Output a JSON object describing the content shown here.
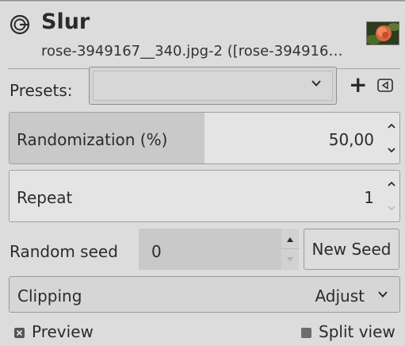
{
  "header": {
    "title": "Slur",
    "subtitle": "rose-3949167__340.jpg-2 ([rose-394916…"
  },
  "presets": {
    "label": "Presets:",
    "value": "",
    "add_label": "+"
  },
  "randomization": {
    "label": "Randomization (%)",
    "value": "50,00",
    "fraction": 0.5
  },
  "repeat": {
    "label": "Repeat",
    "value": "1"
  },
  "seed": {
    "label": "Random seed",
    "value": "0",
    "button_label": "New Seed"
  },
  "clipping": {
    "label": "Clipping",
    "value": "Adjust"
  },
  "preview": {
    "label": "Preview",
    "checked": true
  },
  "split_view": {
    "label": "Split view",
    "checked": false
  }
}
